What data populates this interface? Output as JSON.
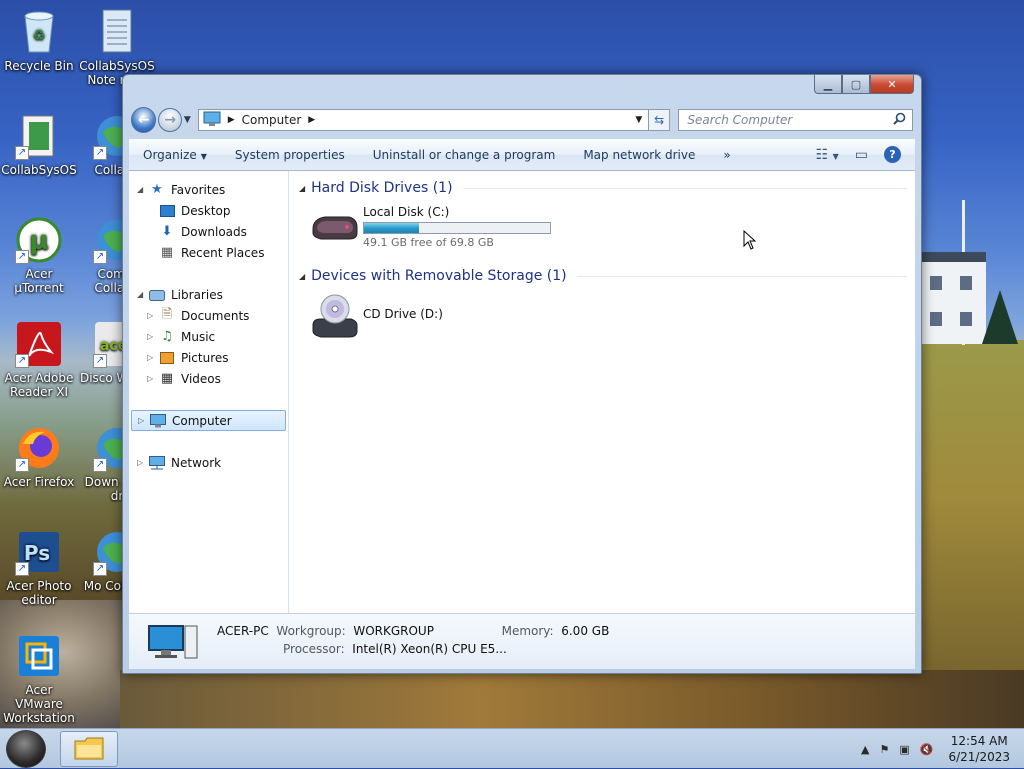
{
  "desktop": {
    "icons": [
      {
        "label": "Recycle Bin"
      },
      {
        "label": "CollabSysOS Note read"
      },
      {
        "label": "CollabSysOS"
      },
      {
        "label": "CollabS"
      },
      {
        "label": "Acer µTorrent"
      },
      {
        "label": "Comm CollabS"
      },
      {
        "label": "Acer Adobe Reader XI"
      },
      {
        "label": "Disco Windo"
      },
      {
        "label": "Acer Firefox"
      },
      {
        "label": "Down Acer dr"
      },
      {
        "label": "Acer Photo editor"
      },
      {
        "label": "Mo CollabS"
      },
      {
        "label": "Acer VMware Workstation"
      }
    ]
  },
  "window": {
    "address": {
      "root_label": "Computer"
    },
    "search": {
      "placeholder": "Search Computer"
    },
    "toolbar": {
      "organize": "Organize",
      "system_properties": "System properties",
      "uninstall": "Uninstall or change a program",
      "map_drive": "Map network drive",
      "more": "»"
    },
    "nav": {
      "favorites": "Favorites",
      "desktop": "Desktop",
      "downloads": "Downloads",
      "recent": "Recent Places",
      "libraries": "Libraries",
      "documents": "Documents",
      "music": "Music",
      "pictures": "Pictures",
      "videos": "Videos",
      "computer": "Computer",
      "network": "Network"
    },
    "groups": {
      "hdd": "Hard Disk Drives (1)",
      "removable": "Devices with Removable Storage (1)"
    },
    "drives": {
      "c": {
        "name": "Local Disk (C:)",
        "free_text": "49.1 GB free of 69.8 GB",
        "used_fraction": 0.297
      },
      "d": {
        "name": "CD Drive (D:)"
      }
    },
    "details": {
      "pc_name": "ACER-PC",
      "workgroup_key": "Workgroup:",
      "workgroup_val": "WORKGROUP",
      "memory_key": "Memory:",
      "memory_val": "6.00 GB",
      "processor_key": "Processor:",
      "processor_val": "Intel(R) Xeon(R) CPU E5..."
    }
  },
  "taskbar": {
    "time": "12:54 AM",
    "date": "6/21/2023"
  }
}
